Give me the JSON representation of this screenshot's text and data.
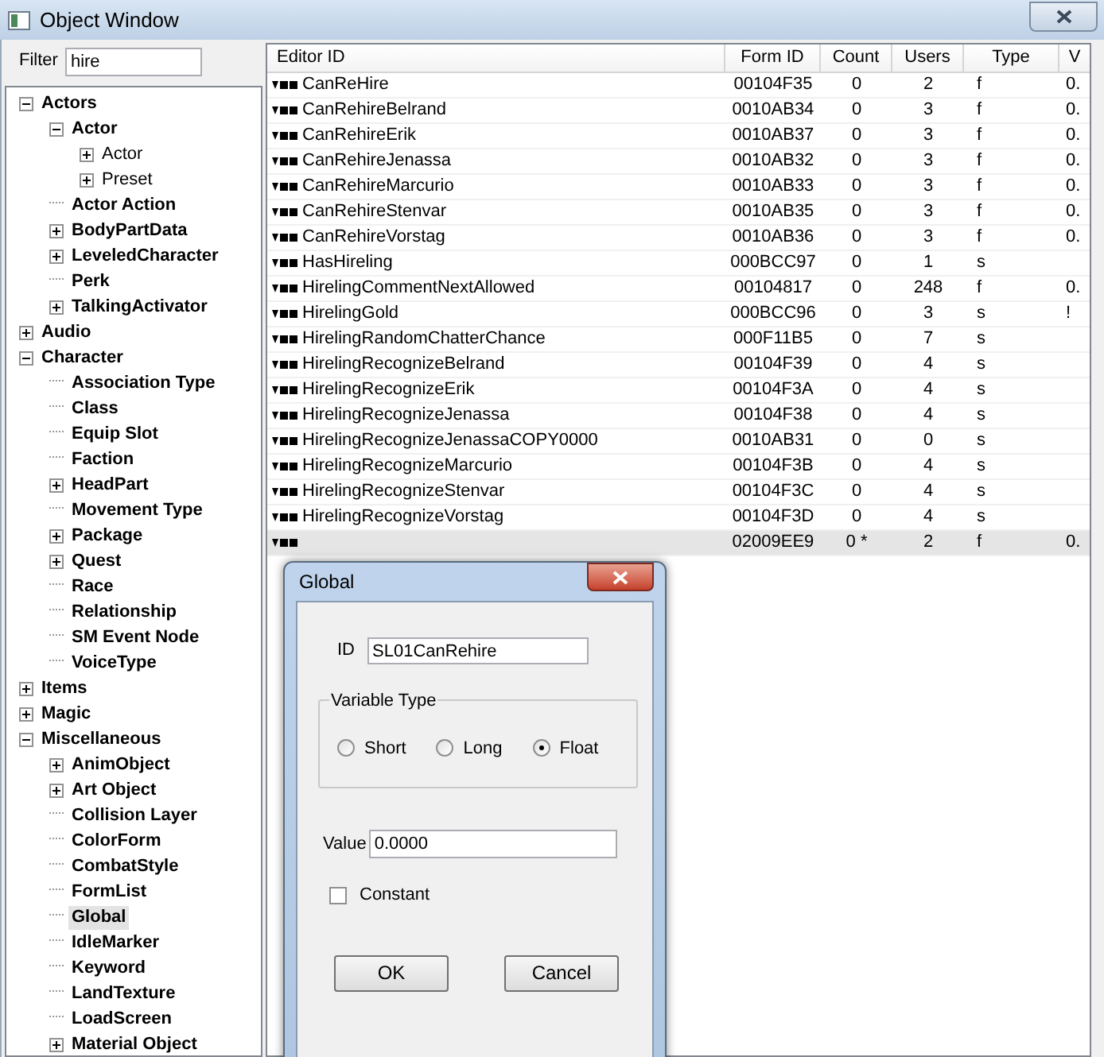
{
  "window": {
    "title": "Object Window"
  },
  "filter": {
    "label": "Filter",
    "value": "hire"
  },
  "tree": [
    {
      "label": "Actors",
      "kind": "expanded",
      "bold": true,
      "selected": false,
      "children": [
        {
          "label": "Actor",
          "kind": "expanded",
          "bold": true,
          "selected": false,
          "children": [
            {
              "label": "Actor",
              "kind": "collapsed",
              "bold": false,
              "selected": false
            },
            {
              "label": "Preset",
              "kind": "collapsed",
              "bold": false,
              "selected": false
            }
          ]
        },
        {
          "label": "Actor Action",
          "kind": "leaf",
          "bold": true,
          "selected": false
        },
        {
          "label": "BodyPartData",
          "kind": "collapsed",
          "bold": true,
          "selected": false
        },
        {
          "label": "LeveledCharacter",
          "kind": "collapsed",
          "bold": true,
          "selected": false
        },
        {
          "label": "Perk",
          "kind": "leaf",
          "bold": true,
          "selected": false
        },
        {
          "label": "TalkingActivator",
          "kind": "collapsed",
          "bold": true,
          "selected": false
        }
      ]
    },
    {
      "label": "Audio",
      "kind": "collapsed",
      "bold": true,
      "selected": false
    },
    {
      "label": "Character",
      "kind": "expanded",
      "bold": true,
      "selected": false,
      "children": [
        {
          "label": "Association Type",
          "kind": "leaf",
          "bold": true,
          "selected": false
        },
        {
          "label": "Class",
          "kind": "leaf",
          "bold": true,
          "selected": false
        },
        {
          "label": "Equip Slot",
          "kind": "leaf",
          "bold": true,
          "selected": false
        },
        {
          "label": "Faction",
          "kind": "leaf",
          "bold": true,
          "selected": false
        },
        {
          "label": "HeadPart",
          "kind": "collapsed",
          "bold": true,
          "selected": false
        },
        {
          "label": "Movement Type",
          "kind": "leaf",
          "bold": true,
          "selected": false
        },
        {
          "label": "Package",
          "kind": "collapsed",
          "bold": true,
          "selected": false
        },
        {
          "label": "Quest",
          "kind": "collapsed",
          "bold": true,
          "selected": false
        },
        {
          "label": "Race",
          "kind": "leaf",
          "bold": true,
          "selected": false
        },
        {
          "label": "Relationship",
          "kind": "leaf",
          "bold": true,
          "selected": false
        },
        {
          "label": "SM Event Node",
          "kind": "leaf",
          "bold": true,
          "selected": false
        },
        {
          "label": "VoiceType",
          "kind": "leaf",
          "bold": true,
          "selected": false
        }
      ]
    },
    {
      "label": "Items",
      "kind": "collapsed",
      "bold": true,
      "selected": false
    },
    {
      "label": "Magic",
      "kind": "collapsed",
      "bold": true,
      "selected": false
    },
    {
      "label": "Miscellaneous",
      "kind": "expanded",
      "bold": true,
      "selected": false,
      "children": [
        {
          "label": "AnimObject",
          "kind": "collapsed",
          "bold": true,
          "selected": false
        },
        {
          "label": "Art Object",
          "kind": "collapsed",
          "bold": true,
          "selected": false
        },
        {
          "label": "Collision Layer",
          "kind": "leaf",
          "bold": true,
          "selected": false
        },
        {
          "label": "ColorForm",
          "kind": "leaf",
          "bold": true,
          "selected": false
        },
        {
          "label": "CombatStyle",
          "kind": "leaf",
          "bold": true,
          "selected": false
        },
        {
          "label": "FormList",
          "kind": "leaf",
          "bold": true,
          "selected": false
        },
        {
          "label": "Global",
          "kind": "leaf",
          "bold": true,
          "selected": true
        },
        {
          "label": "IdleMarker",
          "kind": "leaf",
          "bold": true,
          "selected": false
        },
        {
          "label": "Keyword",
          "kind": "leaf",
          "bold": true,
          "selected": false
        },
        {
          "label": "LandTexture",
          "kind": "leaf",
          "bold": true,
          "selected": false
        },
        {
          "label": "LoadScreen",
          "kind": "leaf",
          "bold": true,
          "selected": false
        },
        {
          "label": "Material Object",
          "kind": "collapsed",
          "bold": true,
          "selected": false
        }
      ]
    }
  ],
  "table": {
    "columns": [
      "Editor ID",
      "Form ID",
      "Count",
      "Users",
      "Type",
      "V"
    ],
    "rows": [
      {
        "cells": [
          "CanReHire",
          "00104F35",
          "0",
          "2",
          "f",
          "0."
        ],
        "selected": false
      },
      {
        "cells": [
          "CanRehireBelrand",
          "0010AB34",
          "0",
          "3",
          "f",
          "0."
        ],
        "selected": false
      },
      {
        "cells": [
          "CanRehireErik",
          "0010AB37",
          "0",
          "3",
          "f",
          "0."
        ],
        "selected": false
      },
      {
        "cells": [
          "CanRehireJenassa",
          "0010AB32",
          "0",
          "3",
          "f",
          "0."
        ],
        "selected": false
      },
      {
        "cells": [
          "CanRehireMarcurio",
          "0010AB33",
          "0",
          "3",
          "f",
          "0."
        ],
        "selected": false
      },
      {
        "cells": [
          "CanRehireStenvar",
          "0010AB35",
          "0",
          "3",
          "f",
          "0."
        ],
        "selected": false
      },
      {
        "cells": [
          "CanRehireVorstag",
          "0010AB36",
          "0",
          "3",
          "f",
          "0."
        ],
        "selected": false
      },
      {
        "cells": [
          "HasHireling",
          "000BCC97",
          "0",
          "1",
          "s",
          ""
        ],
        "selected": false
      },
      {
        "cells": [
          "HirelingCommentNextAllowed",
          "00104817",
          "0",
          "248",
          "f",
          "0."
        ],
        "selected": false
      },
      {
        "cells": [
          "HirelingGold",
          "000BCC96",
          "0",
          "3",
          "s",
          "!"
        ],
        "selected": false
      },
      {
        "cells": [
          "HirelingRandomChatterChance",
          "000F11B5",
          "0",
          "7",
          "s",
          ""
        ],
        "selected": false
      },
      {
        "cells": [
          "HirelingRecognizeBelrand",
          "00104F39",
          "0",
          "4",
          "s",
          ""
        ],
        "selected": false
      },
      {
        "cells": [
          "HirelingRecognizeErik",
          "00104F3A",
          "0",
          "4",
          "s",
          ""
        ],
        "selected": false
      },
      {
        "cells": [
          "HirelingRecognizeJenassa",
          "00104F38",
          "0",
          "4",
          "s",
          ""
        ],
        "selected": false
      },
      {
        "cells": [
          "HirelingRecognizeJenassaCOPY0000",
          "0010AB31",
          "0",
          "0",
          "s",
          ""
        ],
        "selected": false
      },
      {
        "cells": [
          "HirelingRecognizeMarcurio",
          "00104F3B",
          "0",
          "4",
          "s",
          ""
        ],
        "selected": false
      },
      {
        "cells": [
          "HirelingRecognizeStenvar",
          "00104F3C",
          "0",
          "4",
          "s",
          ""
        ],
        "selected": false
      },
      {
        "cells": [
          "HirelingRecognizeVorstag",
          "00104F3D",
          "0",
          "4",
          "s",
          ""
        ],
        "selected": false
      },
      {
        "cells": [
          "",
          "02009EE9",
          "0 *",
          "2",
          "f",
          "0."
        ],
        "selected": true
      }
    ]
  },
  "dialog": {
    "title": "Global",
    "id_label": "ID",
    "id_value": "SL01CanRehire",
    "group_label": "Variable Type",
    "options": [
      {
        "label": "Short",
        "selected": false
      },
      {
        "label": "Long",
        "selected": false
      },
      {
        "label": "Float",
        "selected": true
      }
    ],
    "value_label": "Value",
    "value": "0.0000",
    "constant": {
      "label": "Constant",
      "checked": false
    },
    "buttons": [
      "OK",
      "Cancel"
    ]
  }
}
